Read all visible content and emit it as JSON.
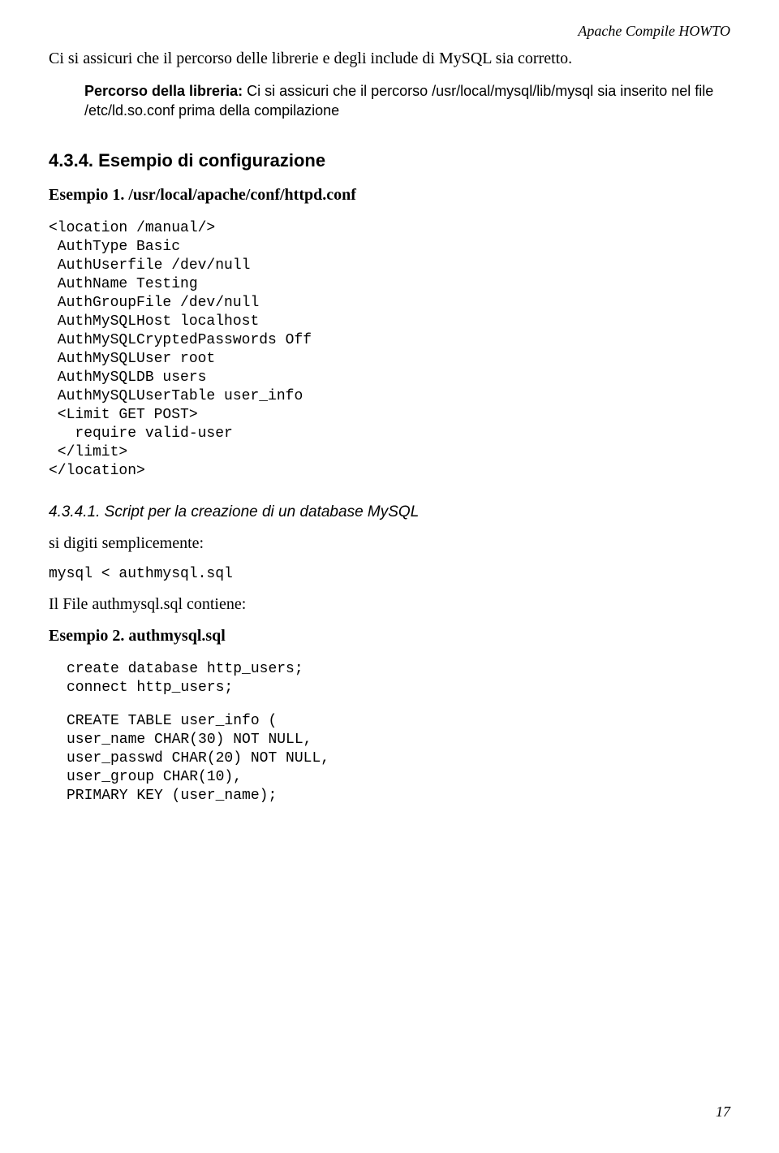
{
  "header": {
    "doc_title": "Apache Compile HOWTO"
  },
  "intro": {
    "line1": "Ci si assicuri che il percorso delle librerie e degli include di MySQL sia corretto.",
    "note_label": "Percorso della libreria:",
    "note_text": " Ci si assicuri che il percorso /usr/local/mysql/lib/mysql sia inserito nel file /etc/ld.so.conf prima della compilazione"
  },
  "section": {
    "h3": "4.3.4. Esempio di configurazione",
    "ex1_title_prefix": "Esempio 1. ",
    "ex1_title_path": "/usr/local/apache/conf/httpd.conf",
    "code1": "<location /manual/>\n AuthType Basic\n AuthUserfile /dev/null\n AuthName Testing\n AuthGroupFile /dev/null\n AuthMySQLHost localhost\n AuthMySQLCryptedPasswords Off\n AuthMySQLUser root\n AuthMySQLDB users\n AuthMySQLUserTable user_info\n <Limit GET POST>\n   require valid-user\n </limit>\n</location>",
    "h4": "4.3.4.1. Script per la creazione di un database MySQL",
    "p_digiti": "si digiti semplicemente:",
    "cmd1": "mysql < authmysql.sql",
    "p_file": "Il File authmysql.sql contiene:",
    "ex2_title": "Esempio 2. authmysql.sql",
    "code2a": "create database http_users;\nconnect http_users;",
    "code2b": "CREATE TABLE user_info (\nuser_name CHAR(30) NOT NULL,\nuser_passwd CHAR(20) NOT NULL,\nuser_group CHAR(10),\nPRIMARY KEY (user_name);"
  },
  "footer": {
    "page_number": "17"
  }
}
